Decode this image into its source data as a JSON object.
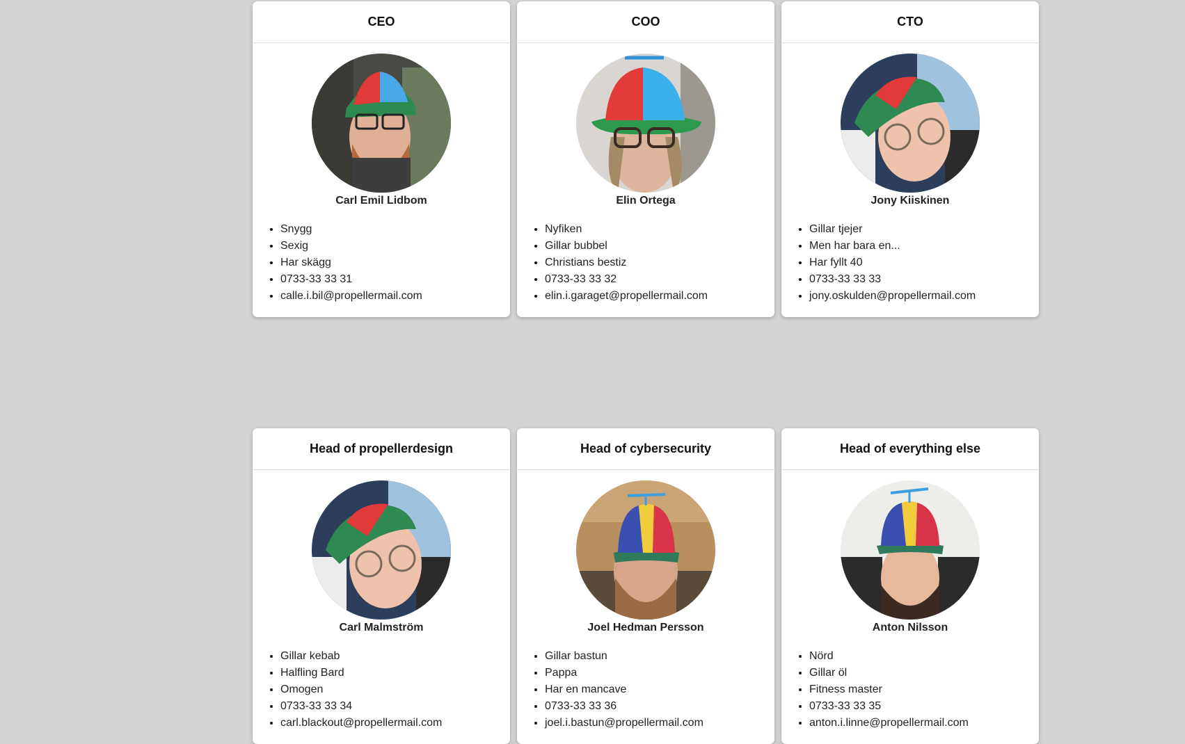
{
  "cards": [
    {
      "title": "CEO",
      "name": "Carl Emil Lidbom",
      "avatar_icon": "person-propeller-cap-photo",
      "facts": [
        "Snygg",
        "Sexig",
        "Har skägg",
        "0733-33 33 31",
        "calle.i.bil@propellermail.com"
      ]
    },
    {
      "title": "COO",
      "name": "Elin Ortega",
      "avatar_icon": "person-propeller-cap-photo",
      "facts": [
        "Nyfiken",
        "Gillar bubbel",
        "Christians bestiz",
        "0733-33 33 32",
        "elin.i.garaget@propellermail.com"
      ]
    },
    {
      "title": "CTO",
      "name": "Jony Kiiskinen",
      "avatar_icon": "person-propeller-cap-photo",
      "facts": [
        "Gillar tjejer",
        "Men har bara en...",
        "Har fyllt 40",
        "0733-33 33 33",
        "jony.oskulden@propellermail.com"
      ]
    },
    {
      "title": "Head of propellerdesign",
      "name": "Carl Malmström",
      "avatar_icon": "person-propeller-cap-photo",
      "facts": [
        "Gillar kebab",
        "Halfling Bard",
        "Omogen",
        "0733-33 33 34",
        "carl.blackout@propellermail.com"
      ]
    },
    {
      "title": "Head of cybersecurity",
      "name": "Joel Hedman Persson",
      "avatar_icon": "person-propeller-cap-photo",
      "facts": [
        "Gillar bastun",
        "Pappa",
        "Har en mancave",
        "0733-33 33 36",
        "joel.i.bastun@propellermail.com"
      ]
    },
    {
      "title": "Head of everything else",
      "name": "Anton Nilsson",
      "avatar_icon": "person-propeller-cap-photo",
      "facts": [
        "Nörd",
        "Gillar öl",
        "Fitness master",
        "0733-33 33 35",
        "anton.i.linne@propellermail.com"
      ]
    }
  ],
  "colors": {
    "page_background": "#d3d3d3",
    "card_background": "#ffffff"
  }
}
